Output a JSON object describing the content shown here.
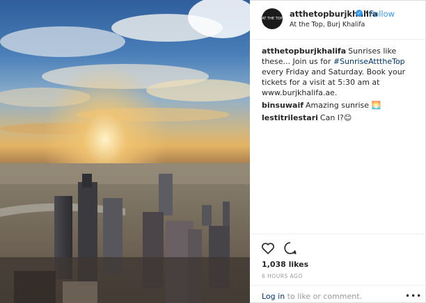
{
  "post": {
    "username": "atthetopburjkhalifa",
    "follow_label": "Follow",
    "separator": "•",
    "location": "At the Top, Burj Khalifa",
    "avatar_text": "AT THE TOP",
    "likes": "1,038 likes",
    "time": "6 HOURS AGO",
    "login_link": "Log in",
    "login_rest": " to like or comment.",
    "more_label": "•••",
    "verified_glyph": "✓"
  },
  "comments": [
    {
      "user": "atthetopburjkhalifa",
      "text_before": "Sunrises like these... Join us for ",
      "hashtag": "#SunriseAtttheTop",
      "text_after": " every Friday and Saturday. Book your tickets for a visit at 5:30 am at www.burjkhalifa.ae."
    },
    {
      "user": "binsuwaif",
      "text": "Amazing sunrise 🌅"
    },
    {
      "user": "lestitrilestari",
      "text": "Can I?😊"
    }
  ],
  "icons": {
    "heart": "heart-icon",
    "comment": "comment-icon",
    "verified": "verified-badge-icon"
  },
  "colors": {
    "link_blue": "#3897f0",
    "hashtag": "#003569",
    "muted": "#999999",
    "text": "#262626"
  }
}
